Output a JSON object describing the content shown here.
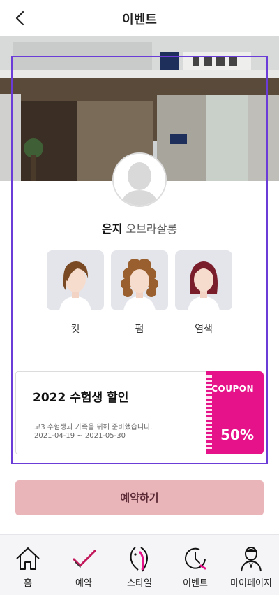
{
  "header": {
    "title": "이벤트"
  },
  "designer": {
    "name": "은지",
    "shop": "오브라살롱"
  },
  "services": [
    {
      "label": "컷"
    },
    {
      "label": "펌"
    },
    {
      "label": "염색"
    }
  ],
  "coupon": {
    "title": "2022 수험생 할인",
    "description": "고3 수험생과 가족을 위해 준비했습니다.",
    "period": "2021-04-19 ~ 2021-05-30",
    "badge": "COUPON",
    "discount": "50%"
  },
  "reserve_button": "예약하기",
  "tabs": [
    {
      "label": "홈",
      "icon": "home-icon"
    },
    {
      "label": "예약",
      "icon": "check-icon"
    },
    {
      "label": "스타일",
      "icon": "style-icon"
    },
    {
      "label": "이벤트",
      "icon": "event-clock-icon"
    },
    {
      "label": "마이페이지",
      "icon": "mypage-icon"
    }
  ],
  "colors": {
    "accent": "#e5128a",
    "button": "#e9b5b9",
    "selection": "#6b3cd8"
  }
}
